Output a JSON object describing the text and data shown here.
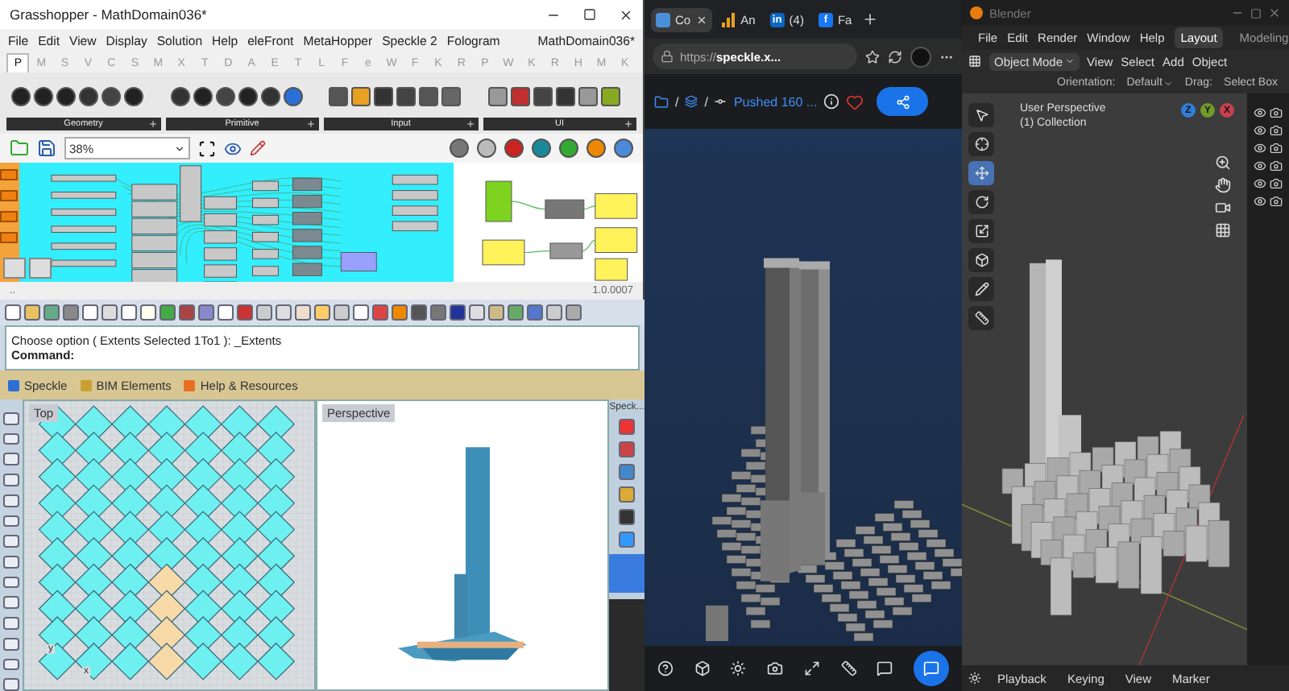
{
  "grasshopper": {
    "title": "Grasshopper - MathDomain036*",
    "menu": [
      "File",
      "Edit",
      "View",
      "Display",
      "Solution",
      "Help",
      "eleFront",
      "MetaHopper",
      "Speckle 2",
      "Fologram"
    ],
    "document": "MathDomain036*",
    "tabs": [
      {
        "label": "P",
        "selected": true
      },
      {
        "label": "M",
        "selected": false
      },
      {
        "label": "S",
        "selected": false
      },
      {
        "label": "V",
        "selected": false
      },
      {
        "label": "C",
        "selected": false
      },
      {
        "label": "S",
        "selected": false
      },
      {
        "label": "M",
        "selected": false
      },
      {
        "label": "X",
        "selected": false
      },
      {
        "label": "T",
        "selected": false
      },
      {
        "label": "D",
        "selected": false
      },
      {
        "label": "A",
        "selected": false
      },
      {
        "label": "E",
        "selected": false
      },
      {
        "label": "T",
        "selected": false
      },
      {
        "label": "L",
        "selected": false
      },
      {
        "label": "F",
        "selected": false
      },
      {
        "label": "e",
        "selected": false
      },
      {
        "label": "W",
        "selected": false
      },
      {
        "label": "F",
        "selected": false
      },
      {
        "label": "K",
        "selected": false
      },
      {
        "label": "R",
        "selected": false
      },
      {
        "label": "P",
        "selected": false
      },
      {
        "label": "W",
        "selected": false
      },
      {
        "label": "K",
        "selected": false
      },
      {
        "label": "R",
        "selected": false
      },
      {
        "label": "H",
        "selected": false
      },
      {
        "label": "M",
        "selected": false
      },
      {
        "label": "K",
        "selected": false
      }
    ],
    "panels": [
      "Geometry",
      "Primitive",
      "Input",
      "UI"
    ],
    "zoom": "38%",
    "status": "..",
    "version": "1.0.0007"
  },
  "rhino": {
    "command_history": "Choose option ( Extents  Selected  1To1 ): _Extents",
    "command_label": "Command:",
    "toolbar_tabs": [
      "Speckle",
      "BIM Elements",
      "Help & Resources"
    ],
    "viewports": [
      {
        "title": "Top",
        "kind": "plan"
      },
      {
        "title": "Perspective",
        "kind": "perspective"
      }
    ],
    "axis_labels": [
      "y",
      "x"
    ],
    "side_panel": "Speck..."
  },
  "browser": {
    "tabs": [
      {
        "label": "Co",
        "selected": true,
        "kind": "page"
      },
      {
        "label": "An",
        "selected": false,
        "kind": "chart"
      },
      {
        "label": "(4)",
        "selected": false,
        "kind": "social",
        "favicon_text": "in",
        "color": "#0a66c2"
      },
      {
        "label": "Fa",
        "selected": false,
        "kind": "social",
        "favicon_text": "f",
        "color": "#1877f2"
      }
    ],
    "url": "https://**speckle.x...**",
    "breadcrumb_separators": [
      "/",
      "/"
    ],
    "commit": "Pushed 160 ..."
  },
  "blender": {
    "title": "Blender",
    "menu": [
      "File",
      "Edit",
      "Render",
      "Window",
      "Help"
    ],
    "workspaces": [
      {
        "label": "Layout",
        "selected": true
      },
      {
        "label": "Modeling",
        "selected": false
      }
    ],
    "mode": "Object Mode",
    "header_menu": [
      "View",
      "Select",
      "Add",
      "Object"
    ],
    "orientation_label": "Orientation:",
    "orientation": "Default",
    "drag_label": "Drag:",
    "drag": "Select Box",
    "view_name": "User Perspective",
    "collection": "(1) Collection",
    "gizmo": [
      {
        "label": "Z",
        "color": "#2f7fd6"
      },
      {
        "label": "Y",
        "color": "#6f9c2a"
      },
      {
        "label": "X",
        "color": "#c9404f"
      }
    ],
    "timeline_menu": [
      "Playback",
      "Keying",
      "View",
      "Marker"
    ]
  }
}
